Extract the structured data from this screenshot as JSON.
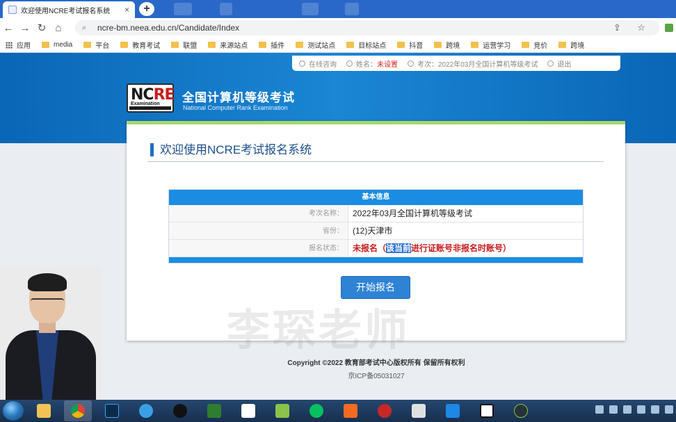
{
  "browser": {
    "tab_title": "欢迎使用NCRE考试报名系统",
    "tab_close": "×",
    "new_tab": "+",
    "url": "ncre-bm.neea.edu.cn/Candidate/Index",
    "nav": {
      "back": "←",
      "forward": "→",
      "reload": "↻",
      "home": "⌂"
    },
    "actions": "⇪ ☆"
  },
  "bookmarks": [
    {
      "label": "应用",
      "kind": "apps"
    },
    {
      "label": "media"
    },
    {
      "label": "平台"
    },
    {
      "label": "教育考试"
    },
    {
      "label": "联盟"
    },
    {
      "label": "来源站点"
    },
    {
      "label": "插件"
    },
    {
      "label": "测试站点"
    },
    {
      "label": "目标站点"
    },
    {
      "label": "抖音"
    },
    {
      "label": "跨境"
    },
    {
      "label": "运营学习"
    },
    {
      "label": "竞价"
    },
    {
      "label": "跨境"
    }
  ],
  "userbar": {
    "online": "在线咨询",
    "name_label": "姓名：",
    "name_value": "未设置",
    "exam_label": "考次：",
    "exam_value": "2022年03月全国计算机等级考试",
    "logout": "退出"
  },
  "brand": {
    "logo_text_a": "NC",
    "logo_text_b": "RE",
    "logo_sub": "Examination",
    "title_cn": "全国计算机等级考试",
    "title_en": "National Computer Rank Examination"
  },
  "main": {
    "heading": "欢迎使用NCRE考试报名系统",
    "info_title": "基本信息",
    "rows": [
      {
        "label": "考次名称：",
        "value": "2022年03月全国计算机等级考试"
      },
      {
        "label": "省份：",
        "value": "(12)天津市"
      }
    ],
    "status_label": "报名状态：",
    "status_prefix": "未报名（",
    "status_selected": "该当前",
    "status_suffix": "进行证账号非报名时账号）",
    "start_button": "开始报名",
    "watermark": "李琛老师"
  },
  "footer": {
    "copyright": "Copyright ©2022 教育部考试中心版权所有 保留所有权利",
    "icp": "京ICP备05031027"
  },
  "colors": {
    "header_blue": "#1a86d4",
    "table_blue": "#1a8de3",
    "status_red": "#c81c1c"
  }
}
